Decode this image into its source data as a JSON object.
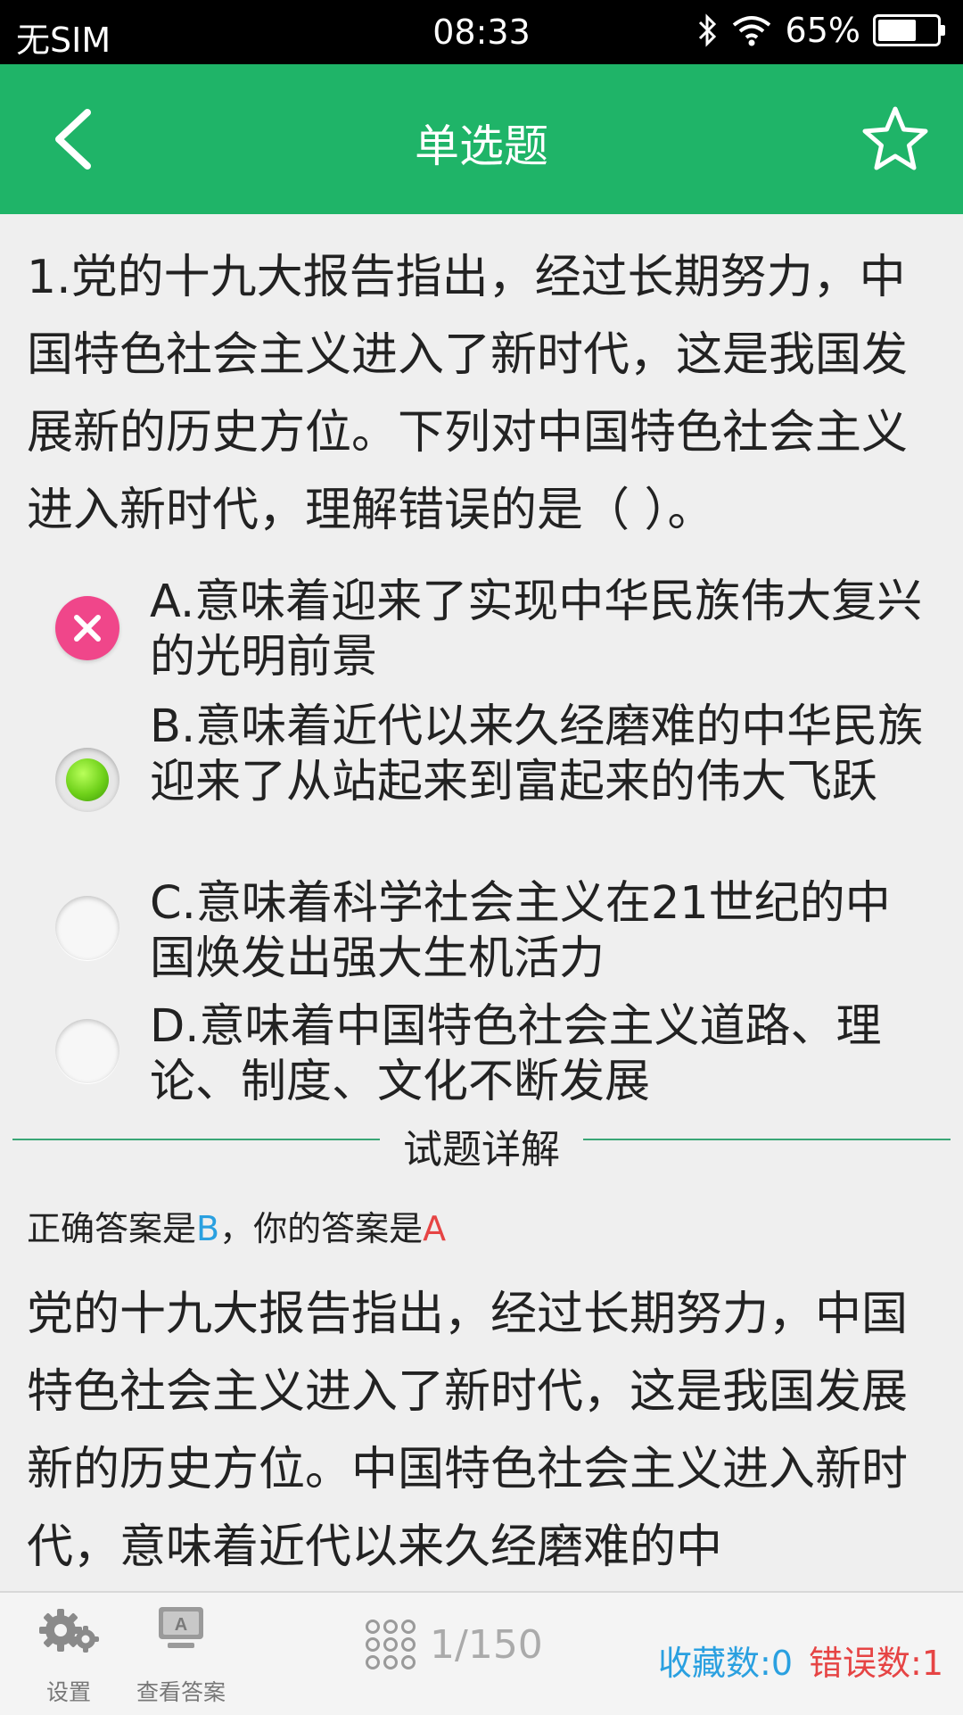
{
  "status_bar": {
    "carrier": "无SIM",
    "time": "08:33",
    "battery_percent": "65%",
    "battery_level": 0.65,
    "icons": [
      "bluetooth-icon",
      "wifi-icon",
      "battery-icon"
    ]
  },
  "header": {
    "title": "单选题",
    "background": "#1fb468",
    "back_icon": "chevron-left-icon",
    "favorite_icon": "star-outline-icon"
  },
  "question": {
    "text": "1.党的十九大报告指出，经过长期努力，中国特色社会主义进入了新时代，这是我国发展新的历史方位。下列对中国特色社会主义进入新时代，理解错误的是（ ）。"
  },
  "options": [
    {
      "text": "A.意味着迎来了实现中华民族伟大复兴的光明前景",
      "state": "wrong"
    },
    {
      "text": "B.意味着近代以来久经磨难的中华民族迎来了从站起来到富起来的伟大飞跃",
      "state": "correct"
    },
    {
      "text": "C.意味着科学社会主义在21世纪的中国焕发出强大生机活力",
      "state": "unselected"
    },
    {
      "text": "D.意味着中国特色社会主义道路、理论、制度、文化不断发展",
      "state": "unselected"
    }
  ],
  "explanation": {
    "section_title": "试题详解",
    "answer_prefix": "正确答案是",
    "correct_answer": "B",
    "answer_middle": "，你的答案是",
    "user_answer": "A",
    "text": "党的十九大报告指出，经过长期努力，中国特色社会主义进入了新时代，这是我国发展新的历史方位。中国特色社会主义进入新时代，意味着近代以来久经磨难的中"
  },
  "bottom_bar": {
    "settings_label": "设置",
    "view_answer_label": "查看答案",
    "progress": "1/150",
    "favorites": "收藏数:0",
    "errors": "错误数:1"
  },
  "colors": {
    "accent_green": "#1fb468",
    "answer_blue": "#2aa0e0",
    "error_red": "#e64444",
    "wrong_mark": "#f0468a"
  }
}
